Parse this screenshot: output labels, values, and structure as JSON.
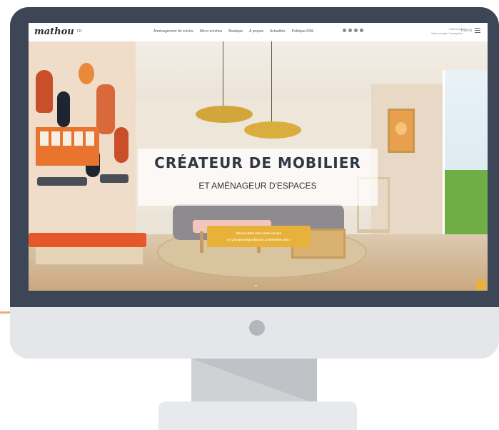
{
  "brand": {
    "logo": "mathou",
    "lang": "FR"
  },
  "nav": {
    "links": [
      "Aménagement de crèche",
      "Micro-crèches",
      "Boutique",
      "À propos",
      "Actualités",
      "Politique RSE"
    ],
    "socials": [
      "instagram-icon",
      "youtube-icon",
      "facebook-icon",
      "linkedin-icon"
    ],
    "account": [
      "Connexion",
      "Mon compte / Inscription"
    ],
    "menu_label": "Menu"
  },
  "hero": {
    "title": "CRÉATEUR DE MOBILIER",
    "subtitle": "ET AMÉNAGEUR D'ESPACES",
    "cta_line1": "DÉCOUVREZ NOS CATALOGUES",
    "cta_line2": "ET LES NOUVEAUTÉS DE LA RENTRÉE 2024 !",
    "scroll_icon": "chevron-down-icon"
  },
  "colors": {
    "frame": "#3d4657",
    "accent": "#e8b13a",
    "chin": "#e4e6ea"
  }
}
